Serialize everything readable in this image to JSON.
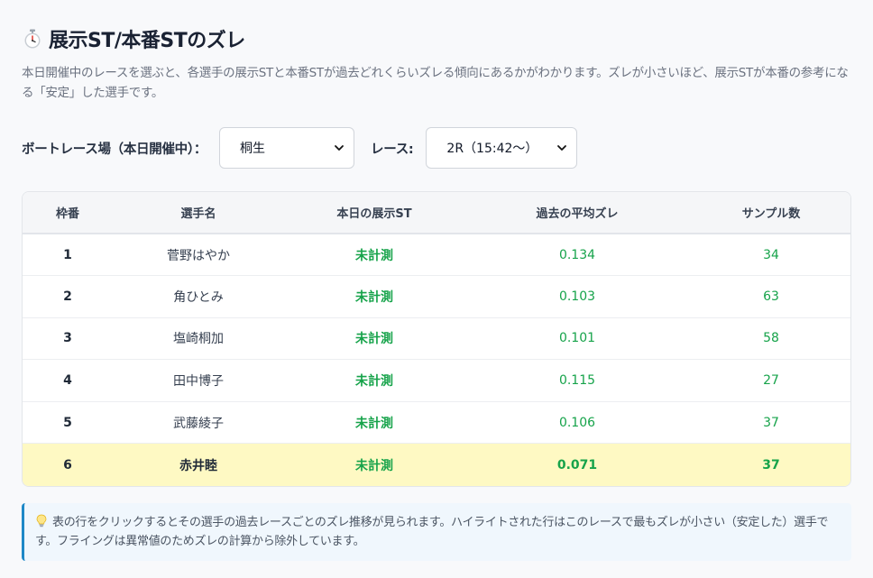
{
  "header": {
    "title": "展示ST/本番STのズレ",
    "description": "本日開催中のレースを選ぶと、各選手の展示STと本番STが過去どれくらいズレる傾向にあるかがわかります。ズレが小さいほど、展示STが本番の参考になる「安定」した選手です。"
  },
  "controls": {
    "venue_label": "ボートレース場（本日開催中）：",
    "venue_value": "桐生",
    "race_label": "レース:",
    "race_value": "2R（15:42〜）"
  },
  "table": {
    "columns": [
      "枠番",
      "選手名",
      "本日の展示ST",
      "過去の平均ズレ",
      "サンプル数"
    ],
    "rows": [
      {
        "frame": "1",
        "name": "菅野はやか",
        "today_st": "未計測",
        "avg_diff": "0.134",
        "samples": "34"
      },
      {
        "frame": "2",
        "name": "角ひとみ",
        "today_st": "未計測",
        "avg_diff": "0.103",
        "samples": "63"
      },
      {
        "frame": "3",
        "name": "塩崎桐加",
        "today_st": "未計測",
        "avg_diff": "0.101",
        "samples": "58"
      },
      {
        "frame": "4",
        "name": "田中博子",
        "today_st": "未計測",
        "avg_diff": "0.115",
        "samples": "27"
      },
      {
        "frame": "5",
        "name": "武藤綾子",
        "today_st": "未計測",
        "avg_diff": "0.106",
        "samples": "37"
      },
      {
        "frame": "6",
        "name": "赤井睦",
        "today_st": "未計測",
        "avg_diff": "0.071",
        "samples": "37"
      }
    ],
    "highlight_row": 6
  },
  "note": {
    "text": "表の行をクリックするとその選手の過去レースごとのズレ推移が見られます。ハイライトされた行はこのレースで最もズレが小さい（安定した）選手です。フライングは異常値のためズレの計算から除外しています。"
  },
  "icons": {
    "title": "stopwatch-icon",
    "note": "lightbulb-icon",
    "select": "chevron-down-icon"
  },
  "colors": {
    "accent_green": "#16a34a",
    "highlight": "#fef9c3",
    "note_border": "#1e88c7"
  }
}
